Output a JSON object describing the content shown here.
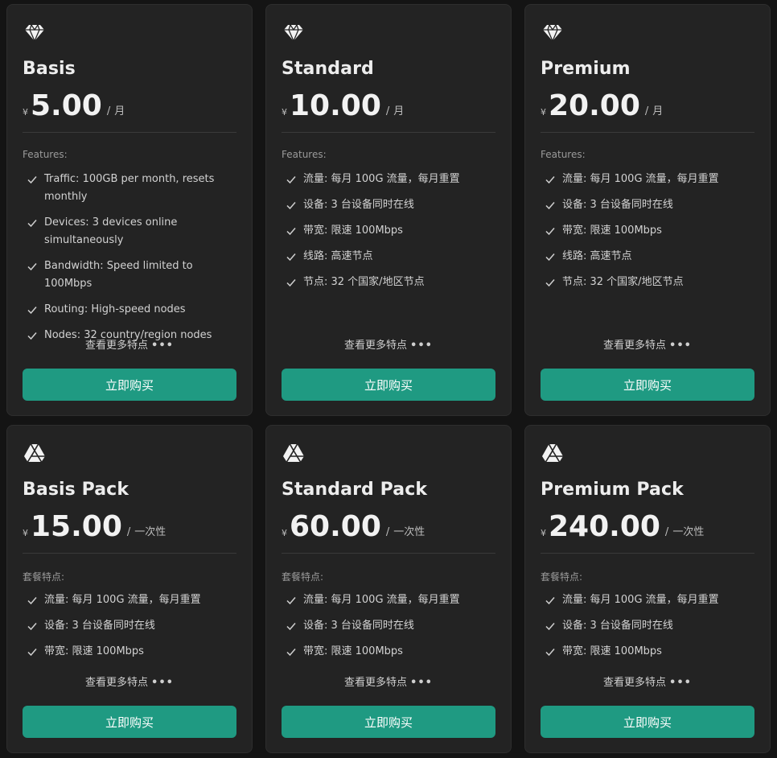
{
  "colors": {
    "accent": "#1f9a82",
    "card_bg": "#232323",
    "page_bg": "#141414"
  },
  "plans": [
    {
      "icon": "diamond-icon",
      "name": "Basis",
      "currency": "¥",
      "amount": "5.00",
      "slash": "/",
      "period": "月",
      "features_title": "Features:",
      "features": [
        "Traffic: 100GB per month, resets monthly",
        "Devices: 3 devices online simultaneously",
        "Bandwidth: Speed limited to 100Mbps",
        "Routing: High-speed nodes",
        "Nodes: 32 country/region nodes"
      ],
      "more_label": "查看更多特点",
      "more_dots": "•••",
      "buy_label": "立即购买"
    },
    {
      "icon": "diamond-icon",
      "name": "Standard",
      "currency": "¥",
      "amount": "10.00",
      "slash": "/",
      "period": "月",
      "features_title": "Features:",
      "features": [
        "流量: 每月 100G 流量，每月重置",
        "设备: 3 台设备同时在线",
        "带宽: 限速 100Mbps",
        "线路: 高速节点",
        "节点: 32 个国家/地区节点"
      ],
      "more_label": "查看更多特点",
      "more_dots": "•••",
      "buy_label": "立即购买"
    },
    {
      "icon": "diamond-icon",
      "name": "Premium",
      "currency": "¥",
      "amount": "20.00",
      "slash": "/",
      "period": "月",
      "features_title": "Features:",
      "features": [
        "流量: 每月 100G 流量，每月重置",
        "设备: 3 台设备同时在线",
        "带宽: 限速 100Mbps",
        "线路: 高速节点",
        "节点: 32 个国家/地区节点"
      ],
      "more_label": "查看更多特点",
      "more_dots": "•••",
      "buy_label": "立即购买"
    },
    {
      "icon": "drive-icon",
      "name": "Basis Pack",
      "currency": "¥",
      "amount": "15.00",
      "slash": "/",
      "period": "一次性",
      "features_title": "套餐特点:",
      "features": [
        "流量: 每月 100G 流量，每月重置",
        "设备: 3 台设备同时在线",
        "带宽: 限速 100Mbps"
      ],
      "more_label": "查看更多特点",
      "more_dots": "•••",
      "buy_label": "立即购买"
    },
    {
      "icon": "drive-icon",
      "name": "Standard Pack",
      "currency": "¥",
      "amount": "60.00",
      "slash": "/",
      "period": "一次性",
      "features_title": "套餐特点:",
      "features": [
        "流量: 每月 100G 流量，每月重置",
        "设备: 3 台设备同时在线",
        "带宽: 限速 100Mbps"
      ],
      "more_label": "查看更多特点",
      "more_dots": "•••",
      "buy_label": "立即购买"
    },
    {
      "icon": "drive-icon",
      "name": "Premium Pack",
      "currency": "¥",
      "amount": "240.00",
      "slash": "/",
      "period": "一次性",
      "features_title": "套餐特点:",
      "features": [
        "流量: 每月 100G 流量，每月重置",
        "设备: 3 台设备同时在线",
        "带宽: 限速 100Mbps"
      ],
      "more_label": "查看更多特点",
      "more_dots": "•••",
      "buy_label": "立即购买"
    }
  ]
}
